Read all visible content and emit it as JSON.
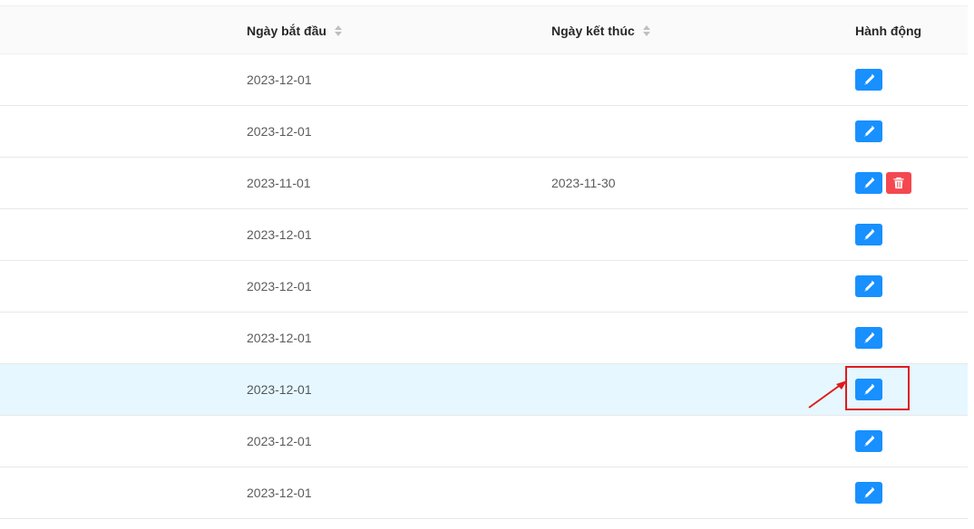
{
  "table": {
    "headers": {
      "start_date": "Ngày bắt đầu",
      "end_date": "Ngày kết thúc",
      "actions": "Hành động"
    },
    "rows": [
      {
        "start_date": "2023-12-01",
        "end_date": "",
        "delete": false
      },
      {
        "start_date": "2023-12-01",
        "end_date": "",
        "delete": false
      },
      {
        "start_date": "2023-11-01",
        "end_date": "2023-11-30",
        "delete": true
      },
      {
        "start_date": "2023-12-01",
        "end_date": "",
        "delete": false
      },
      {
        "start_date": "2023-12-01",
        "end_date": "",
        "delete": false
      },
      {
        "start_date": "2023-12-01",
        "end_date": "",
        "delete": false
      },
      {
        "start_date": "2023-12-01",
        "end_date": "",
        "delete": false,
        "highlighted": true
      },
      {
        "start_date": "2023-12-01",
        "end_date": "",
        "delete": false
      },
      {
        "start_date": "2023-12-01",
        "end_date": "",
        "delete": false
      }
    ]
  },
  "icons": {
    "edit": "pencil-icon",
    "delete": "trash-icon",
    "sort": "sort-icon"
  },
  "colors": {
    "edit_button": "#1890ff",
    "delete_button": "#f5474f",
    "highlight_row": "#e6f7ff",
    "annotation": "#e01b1b"
  }
}
